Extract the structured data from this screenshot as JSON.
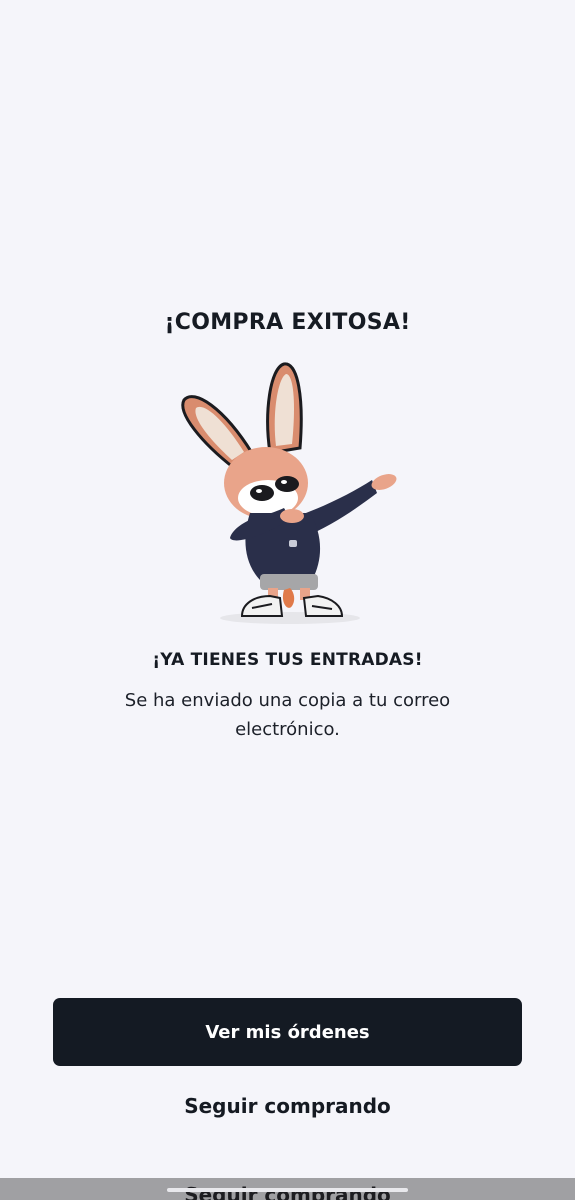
{
  "success": {
    "title": "¡COMPRA EXITOSA!",
    "subtitle": "¡YA TIENES TUS ENTRADAS!",
    "message": "Se ha enviado una copia a tu correo electrónico."
  },
  "mascot": {
    "icon": "rabbit-mascot-dab-icon",
    "colors": {
      "fur": "#e9a48a",
      "sweater": "#2a2f4a",
      "shorts": "#a6a6a8"
    }
  },
  "actions": {
    "primary_label": "Ver mis órdenes",
    "secondary_label": "Seguir comprando"
  },
  "colors": {
    "background": "#f5f5fa",
    "primary_button": "#141a23",
    "text": "#161b23"
  }
}
